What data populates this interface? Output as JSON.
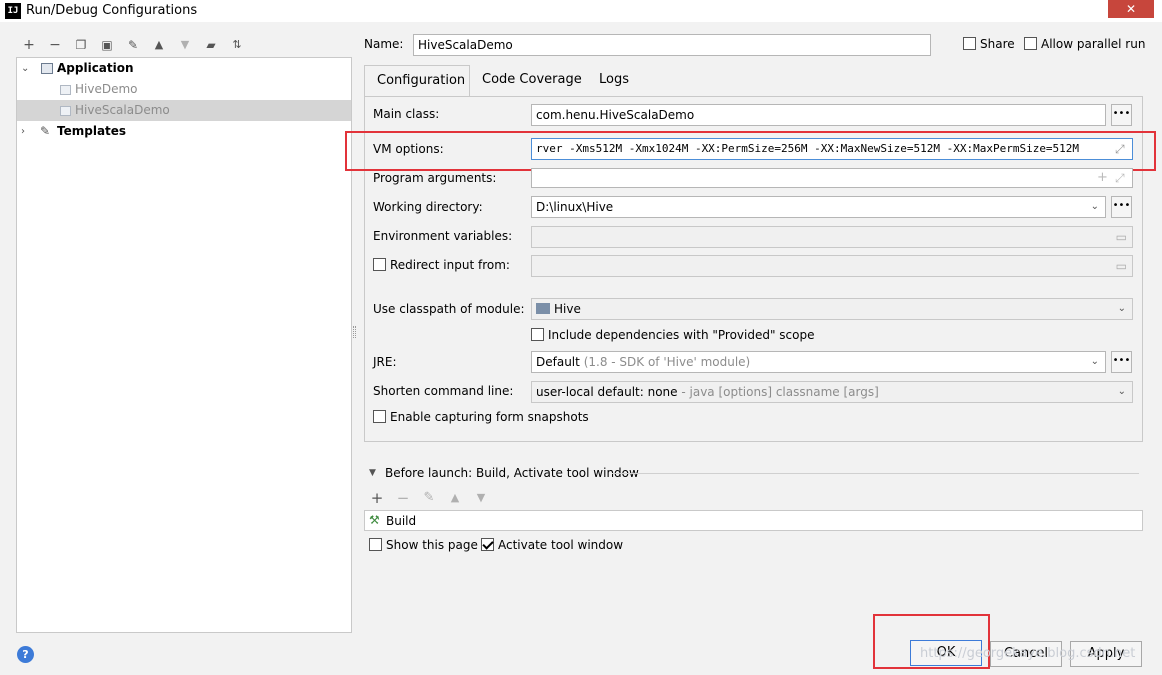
{
  "window": {
    "title": "Run/Debug Configurations",
    "logo_text": "IJ"
  },
  "toolbar": {
    "icons": [
      "add-icon",
      "remove-icon",
      "copy-icon",
      "save-icon",
      "wrench-icon",
      "move-up-icon",
      "move-down-icon",
      "new-folder-icon",
      "sort-icon"
    ]
  },
  "tree": {
    "application_label": "Application",
    "items": [
      {
        "label": "HiveDemo"
      },
      {
        "label": "HiveScalaDemo"
      }
    ],
    "templates_label": "Templates"
  },
  "header": {
    "name_label": "Name:",
    "name_value": "HiveScalaDemo",
    "share_label": "Share",
    "allow_parallel_label": "Allow parallel run"
  },
  "tabs": [
    {
      "label": "Configuration"
    },
    {
      "label": "Code Coverage"
    },
    {
      "label": "Logs"
    }
  ],
  "form": {
    "main_class_label": "Main class:",
    "main_class_value": "com.henu.HiveScalaDemo",
    "vm_options_label": "VM options:",
    "vm_options_value": "rver -Xms512M -Xmx1024M -XX:PermSize=256M -XX:MaxNewSize=512M -XX:MaxPermSize=512M",
    "program_args_label": "Program arguments:",
    "working_dir_label": "Working directory:",
    "working_dir_value": "D:\\linux\\Hive",
    "env_vars_label": "Environment variables:",
    "redirect_label": "Redirect input from:",
    "classpath_label": "Use classpath of module:",
    "classpath_value": "Hive",
    "include_deps_label": "Include dependencies with \"Provided\" scope",
    "jre_label": "JRE:",
    "jre_value": "Default",
    "jre_hint": "(1.8 - SDK of 'Hive' module)",
    "shorten_label": "Shorten command line:",
    "shorten_value": "user-local default: none",
    "shorten_hint": "- java [options] classname [args]",
    "snapshots_label": "Enable capturing form snapshots"
  },
  "before_launch": {
    "title": "Before launch: Build, Activate tool window",
    "task_label": "Build",
    "show_page_label": "Show this page",
    "activate_label": "Activate tool window"
  },
  "buttons": {
    "ok": "OK",
    "cancel": "Cancel",
    "apply": "Apply",
    "help": "?"
  },
  "watermark": "https://georgekaye.blog.csdn.net"
}
